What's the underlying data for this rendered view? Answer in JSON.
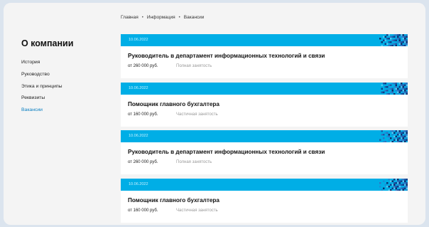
{
  "breadcrumb": [
    "Главная",
    "Информация",
    "Вакансии"
  ],
  "sidebar": {
    "title": "О компании",
    "items": [
      {
        "label": "История"
      },
      {
        "label": "Руководство"
      },
      {
        "label": "Этика и принципы"
      },
      {
        "label": "Реквизиты"
      },
      {
        "label": "Вакансии",
        "active": true
      }
    ]
  },
  "vacancies": [
    {
      "date": "10.06.2022",
      "title": "Руководитель в департамент информационных технологий и связи",
      "salary": "от 260 000 руб.",
      "employment": "Полная занятость"
    },
    {
      "date": "10.06.2022",
      "title": "Помощник главного бухгалтера",
      "salary": "от 160 000 руб.",
      "employment": "Частичная занятость"
    },
    {
      "date": "10.06.2022",
      "title": "Руководитель в департамент информационных технологий и связи",
      "salary": "от 260 000 руб.",
      "employment": "Полная занятость"
    },
    {
      "date": "10.06.2022",
      "title": "Помощник главного бухгалтера",
      "salary": "от 160 000 руб.",
      "employment": "Частичная занятость"
    }
  ],
  "colors": {
    "accent": "#00aee6",
    "active_link": "#0a7fc2",
    "pattern_dark": "#0d3f8a"
  },
  "icons": {
    "card_pattern": "pixel-mosaic-decoration"
  }
}
